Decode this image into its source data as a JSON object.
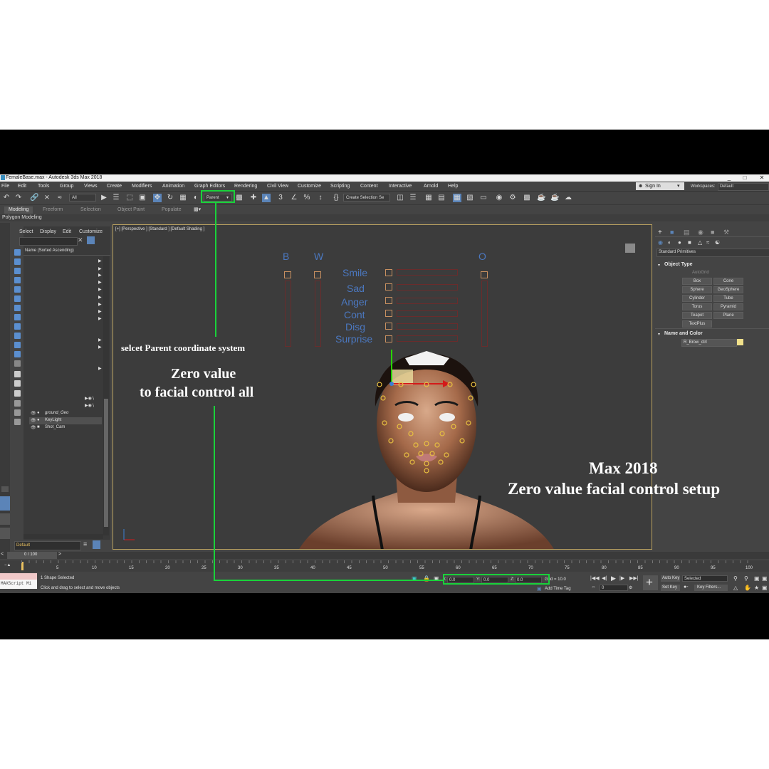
{
  "window": {
    "title": "FemaleBase.max - Autodesk 3ds Max 2018",
    "controls": [
      "_",
      "□",
      "✕"
    ]
  },
  "menu": [
    "File",
    "Edit",
    "Tools",
    "Group",
    "Views",
    "Create",
    "Modifiers",
    "Animation",
    "Graph Editors",
    "Rendering",
    "Civil View",
    "Customize",
    "Scripting",
    "Content",
    "Interactive",
    "Arnold",
    "Help"
  ],
  "account": {
    "sign_in": "Sign In",
    "workspaces_label": "Workspaces:",
    "workspace": "Default"
  },
  "toolbar": {
    "selection_filter": "All",
    "reference_coord": "Parent",
    "named_selection": "Create Selection Se"
  },
  "ribbon": {
    "tabs": [
      "Modeling",
      "Freeform",
      "Selection",
      "Object Paint",
      "Populate"
    ],
    "active_tab": "Modeling",
    "sub": "Polygon Modeling"
  },
  "explorer": {
    "menu": [
      "Select",
      "Display",
      "Edit",
      "Customize"
    ],
    "sort_label": "Name (Sorted Ascending)",
    "items": [
      "ground_Geo",
      "KeyLight",
      "Shot_Cam"
    ],
    "layer": "Default",
    "frame": "0 / 100"
  },
  "viewport": {
    "label": "[+] [Perspective ] [Standard ] [Default Shading ]",
    "column_labels": [
      "B",
      "W",
      "O"
    ],
    "controls": [
      "Smile",
      "Sad",
      "Anger",
      "Cont",
      "Disg",
      "Surprise"
    ]
  },
  "command_panel": {
    "category": "Standard Primitives",
    "object_type_title": "Object Type",
    "autogrid": "AutoGrid",
    "primitives": [
      "Box",
      "Cone",
      "Sphere",
      "GeoSphere",
      "Cylinder",
      "Tube",
      "Torus",
      "Pyramid",
      "Teapot",
      "Plane",
      "TextPlus"
    ],
    "name_color_title": "Name and Color",
    "object_name": "R_Brow_ctrl",
    "object_color": "#f0e08a"
  },
  "timeline": {
    "ticks": [
      "5",
      "10",
      "15",
      "20",
      "25",
      "30",
      "35",
      "40",
      "45",
      "50",
      "55",
      "60",
      "65",
      "70",
      "75",
      "80",
      "85",
      "90",
      "95",
      "100"
    ]
  },
  "status": {
    "maxscript": "MAXScript Mi",
    "selection": "1 Shape Selected",
    "prompt": "Click and drag to select and move objects",
    "x_label": "X:",
    "x": "0.0",
    "y_label": "Y:",
    "y": "0.0",
    "z_label": "Z:",
    "z": "0.0",
    "grid": "Grid = 10.0",
    "add_time_tag": "Add Time Tag",
    "auto_key": "Auto Key",
    "set_key": "Set Key",
    "key_mode": "Selected",
    "key_filters": "Key Filters...",
    "current_frame": "0"
  },
  "annotations": {
    "parent_note": "selcet Parent coordinate system",
    "zero_line1": "Zero value",
    "zero_line2": "to facial control all",
    "title_line1": "Max 2018",
    "title_line2": "Zero value facial control setup"
  },
  "colors": {
    "highlight": "#19d23a",
    "accent": "#5b84b8",
    "face_label": "#4b78c0"
  }
}
